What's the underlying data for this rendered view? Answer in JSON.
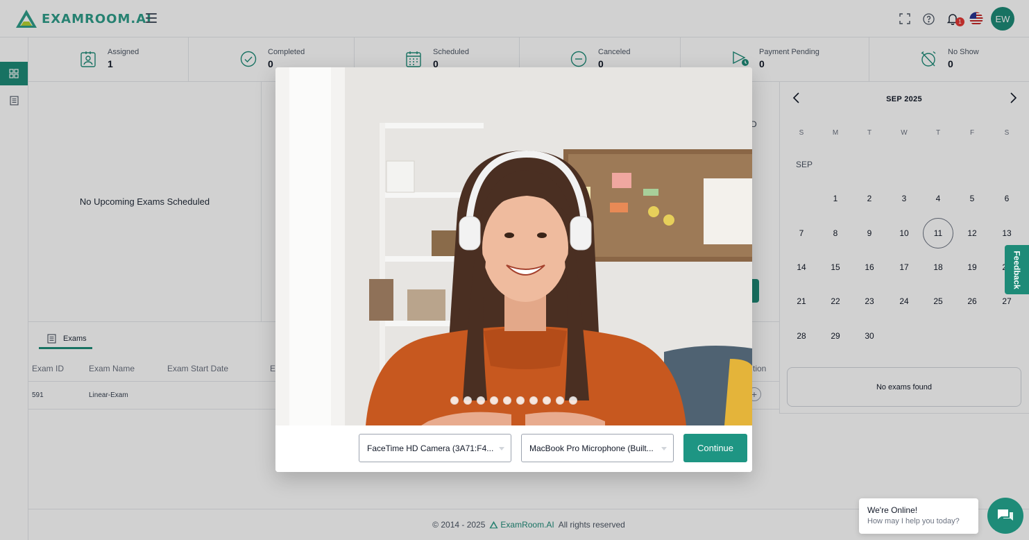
{
  "brand": {
    "logo_text": "EXAMROOM.AI",
    "accent": "#1e8b78"
  },
  "header": {
    "icons": [
      "fullscreen-icon",
      "help-icon",
      "bell-icon",
      "us-flag-icon"
    ],
    "notification_count": "1",
    "avatar_initials": "EW"
  },
  "sidebar": {
    "items": [
      "dashboard-icon",
      "list-icon"
    ]
  },
  "stats": [
    {
      "label": "Assigned",
      "value": "1",
      "icon": "user-badge-icon"
    },
    {
      "label": "Completed",
      "value": "0",
      "icon": "check-circle-icon"
    },
    {
      "label": "Scheduled",
      "value": "0",
      "icon": "calendar-icon"
    },
    {
      "label": "Canceled",
      "value": "0",
      "icon": "minus-circle-icon"
    },
    {
      "label": "Payment Pending",
      "value": "0",
      "icon": "payment-pending-icon"
    },
    {
      "label": "No Show",
      "value": "0",
      "icon": "alarm-off-icon"
    }
  ],
  "upcoming": {
    "empty_text": "No Upcoming Exams Scheduled"
  },
  "mid_panel": {
    "partial_letter": "D"
  },
  "calendar": {
    "month_label": "SEP 2025",
    "section_label": "SEP",
    "weekdays": [
      "S",
      "M",
      "T",
      "W",
      "T",
      "F",
      "S"
    ],
    "days": [
      "1",
      "2",
      "3",
      "4",
      "5",
      "6",
      "7",
      "8",
      "9",
      "10",
      "11",
      "12",
      "13",
      "14",
      "15",
      "16",
      "17",
      "18",
      "19",
      "20",
      "21",
      "22",
      "23",
      "24",
      "25",
      "26",
      "27",
      "28",
      "29",
      "30"
    ],
    "today": "11",
    "empty_text": "No exams found"
  },
  "exams": {
    "tab_label": "Exams",
    "columns": [
      "Exam ID",
      "Exam Name",
      "Exam Start Date",
      "E"
    ],
    "action_header": "tion",
    "rows": [
      {
        "id": "591",
        "name": "Linear-Exam"
      }
    ]
  },
  "modal": {
    "camera_value": "FaceTime HD Camera (3A71:F4...",
    "microphone_value": "MacBook Pro Microphone (Built...",
    "continue_label": "Continue",
    "slide_count": 10
  },
  "feedback_label": "Feedback",
  "chat": {
    "title": "We're Online!",
    "subtitle": "How may I help you today?"
  },
  "footer": {
    "copyright": "© 2014 - 2025",
    "brand": "ExamRoom.AI",
    "rights": "All rights reserved"
  }
}
